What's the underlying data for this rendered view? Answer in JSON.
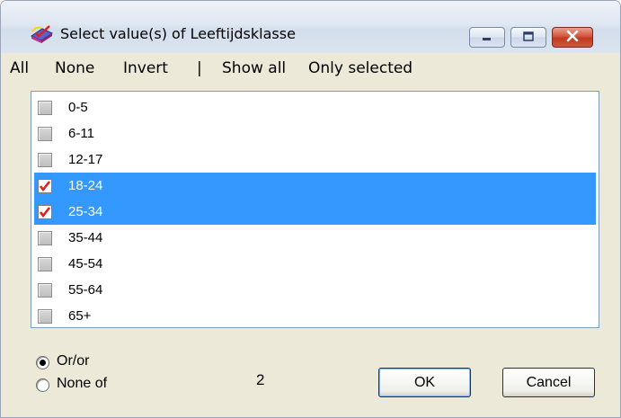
{
  "window": {
    "title": "Select value(s) of Leeftijdsklasse"
  },
  "menubar": {
    "all": "All",
    "none": "None",
    "invert": "Invert",
    "separator": "|",
    "show_all": "Show all",
    "only_selected": "Only selected"
  },
  "list": {
    "items": [
      {
        "label": "0-5",
        "checked": false,
        "selected": false
      },
      {
        "label": "6-11",
        "checked": false,
        "selected": false
      },
      {
        "label": "12-17",
        "checked": false,
        "selected": false
      },
      {
        "label": "18-24",
        "checked": true,
        "selected": true
      },
      {
        "label": "25-34",
        "checked": true,
        "selected": true
      },
      {
        "label": "35-44",
        "checked": false,
        "selected": false
      },
      {
        "label": "45-54",
        "checked": false,
        "selected": false
      },
      {
        "label": "55-64",
        "checked": false,
        "selected": false
      },
      {
        "label": "65+",
        "checked": false,
        "selected": false
      }
    ]
  },
  "options": {
    "or_label": "Or/or",
    "none_of_label": "None of",
    "selected_option": "or"
  },
  "footer": {
    "count": "2",
    "ok_label": "OK",
    "cancel_label": "Cancel"
  },
  "colors": {
    "selection": "#3399ff",
    "check_mark": "#e0201b",
    "close_button": "#c0391f"
  },
  "icons": {
    "app": "select-values-app-icon",
    "minimize": "minimize-icon",
    "maximize": "maximize-icon",
    "close": "close-icon"
  }
}
